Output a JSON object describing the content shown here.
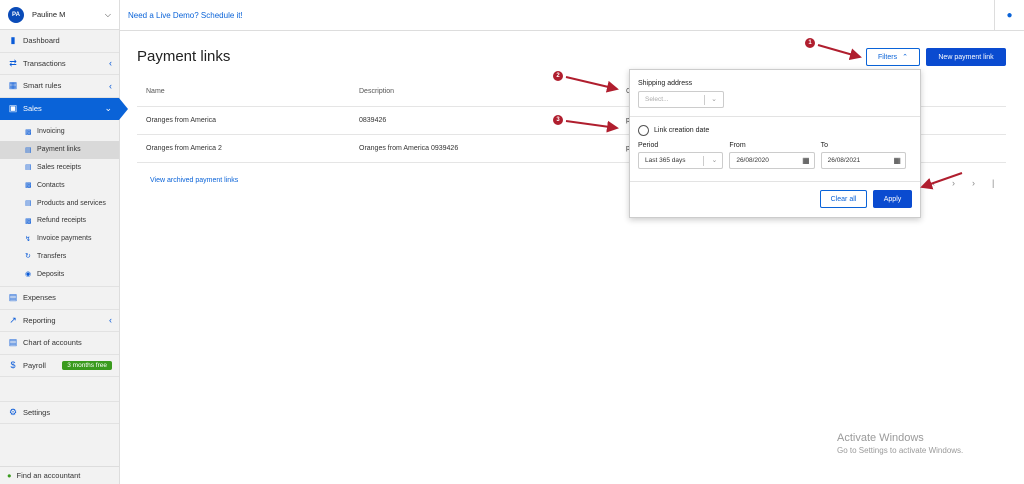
{
  "sidebar": {
    "user": {
      "initials": "PA",
      "name": "Pauline M"
    },
    "items": [
      {
        "label": "Dashboard",
        "icon": "bar-chart-icon"
      },
      {
        "label": "Transactions",
        "icon": "transfer-arrows-icon"
      },
      {
        "label": "Smart rules",
        "icon": "rules-icon"
      },
      {
        "label": "Sales",
        "icon": "cart-icon"
      }
    ],
    "sales_sub": [
      {
        "label": "Invoicing",
        "icon": "invoice-icon"
      },
      {
        "label": "Payment links",
        "icon": "card-icon"
      },
      {
        "label": "Sales receipts",
        "icon": "receipt-icon"
      },
      {
        "label": "Contacts",
        "icon": "contact-icon"
      },
      {
        "label": "Products and services",
        "icon": "product-icon"
      },
      {
        "label": "Refund receipts",
        "icon": "refund-icon"
      },
      {
        "label": "Invoice payments",
        "icon": "payment-icon"
      },
      {
        "label": "Transfers",
        "icon": "transfer-icon"
      },
      {
        "label": "Deposits",
        "icon": "deposit-icon"
      }
    ],
    "items_after": [
      {
        "label": "Expenses",
        "icon": "expenses-icon"
      },
      {
        "label": "Reporting",
        "icon": "trend-icon"
      },
      {
        "label": "Chart of accounts",
        "icon": "ledger-icon"
      },
      {
        "label": "Payroll",
        "icon": "dollar-icon",
        "badge": "3 months free"
      }
    ],
    "settings": "Settings",
    "find_accountant": "Find an accountant"
  },
  "topbar": {
    "demo_text": "Need a Live Demo? Schedule it!"
  },
  "main": {
    "title": "Payment links",
    "filters_label": "Filters",
    "new_label": "New payment link",
    "columns": [
      "Name",
      "Description",
      "C"
    ],
    "rows": [
      {
        "name": "Oranges from America",
        "description": "0839426",
        "extra": "p"
      },
      {
        "name": "Oranges from America 2",
        "description": "Oranges from America 0939426",
        "extra": "p"
      }
    ],
    "archived_link": "View archived payment links"
  },
  "filters_popover": {
    "shipping_label": "Shipping address",
    "shipping_placeholder": "Select...",
    "link_creation_label": "Link creation date",
    "period_label": "Period",
    "period_value": "Last 365 days",
    "from_label": "From",
    "from_value": "26/08/2020",
    "to_label": "To",
    "to_value": "26/08/2021",
    "clear_label": "Clear all",
    "apply_label": "Apply"
  },
  "callouts": [
    "1",
    "2",
    "3"
  ],
  "watermark": {
    "line1": "Activate Windows",
    "line2": "Go to Settings to activate Windows."
  },
  "colors": {
    "accent": "#0a63d8",
    "primary_button": "#0a4bd0",
    "callout": "#b01e2e",
    "badge": "#3a9b1e"
  }
}
